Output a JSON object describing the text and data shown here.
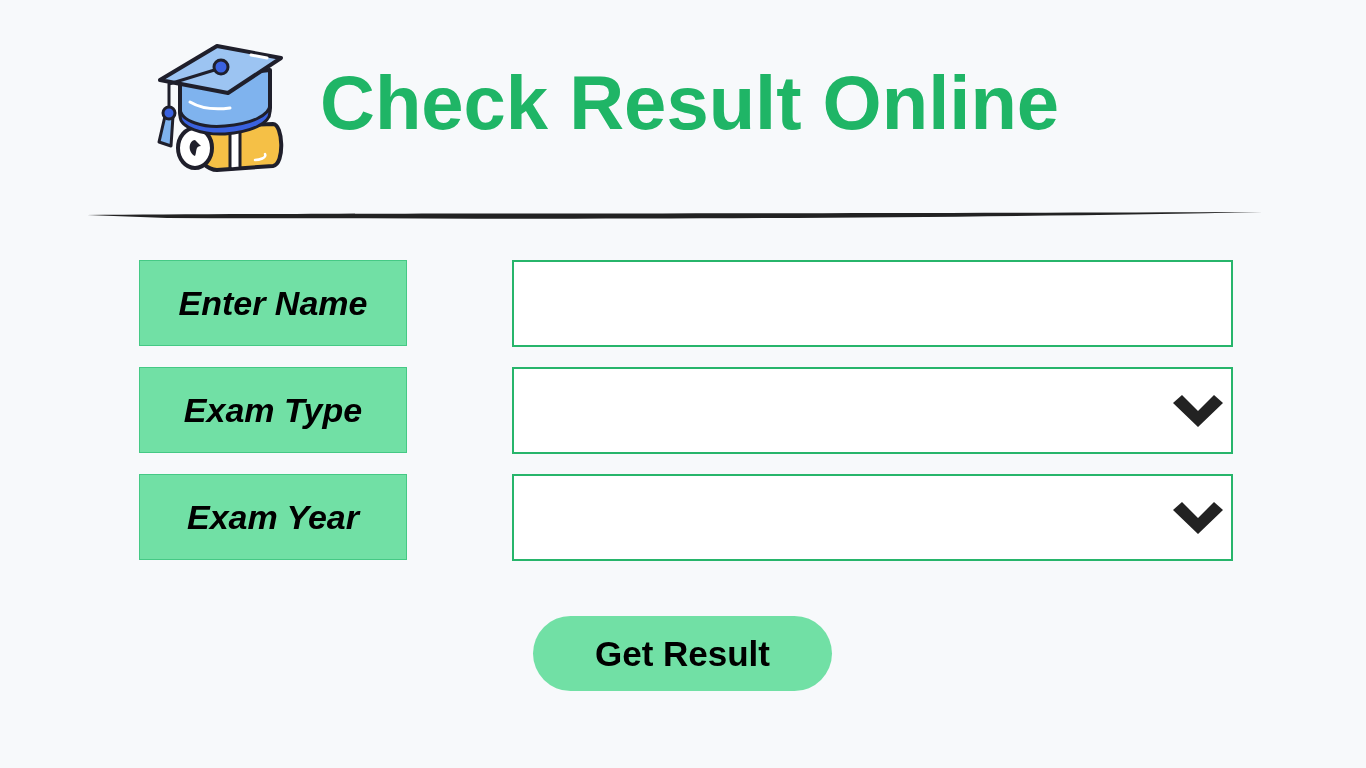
{
  "header": {
    "title": "Check Result Online"
  },
  "form": {
    "fields": [
      {
        "label": "Enter Name",
        "kind": "text"
      },
      {
        "label": "Exam Type",
        "kind": "select"
      },
      {
        "label": "Exam Year",
        "kind": "select"
      }
    ],
    "submit": {
      "label": "Get Result"
    }
  }
}
